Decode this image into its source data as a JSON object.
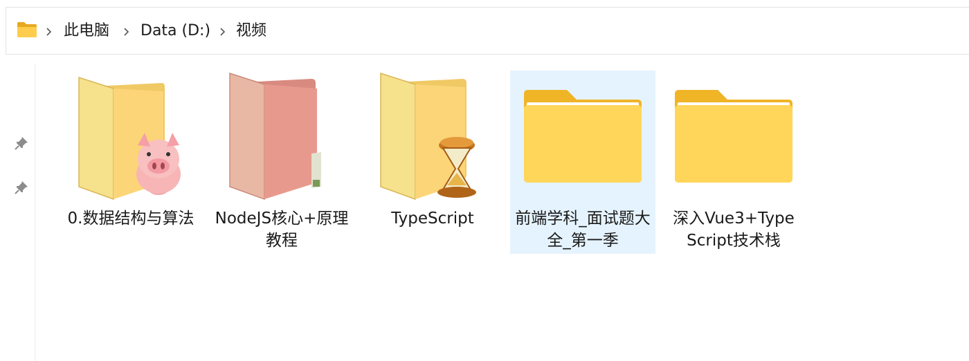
{
  "breadcrumb": {
    "items": [
      {
        "label": "此电脑"
      },
      {
        "label": "Data (D:)"
      },
      {
        "label": "视频"
      }
    ]
  },
  "files": [
    {
      "name": "0.数据结构与算法",
      "icon": "folder-with-pig-icon",
      "selected": false
    },
    {
      "name": "NodeJS核心+原理教程",
      "icon": "red-folder-icon",
      "selected": false
    },
    {
      "name": "TypeScript",
      "icon": "folder-with-hourglass-icon",
      "selected": false
    },
    {
      "name": "前端学科_面试题大全_第一季",
      "icon": "folder-icon",
      "selected": true
    },
    {
      "name": "深入Vue3+TypeScript技术栈",
      "icon": "folder-icon",
      "selected": false
    }
  ]
}
